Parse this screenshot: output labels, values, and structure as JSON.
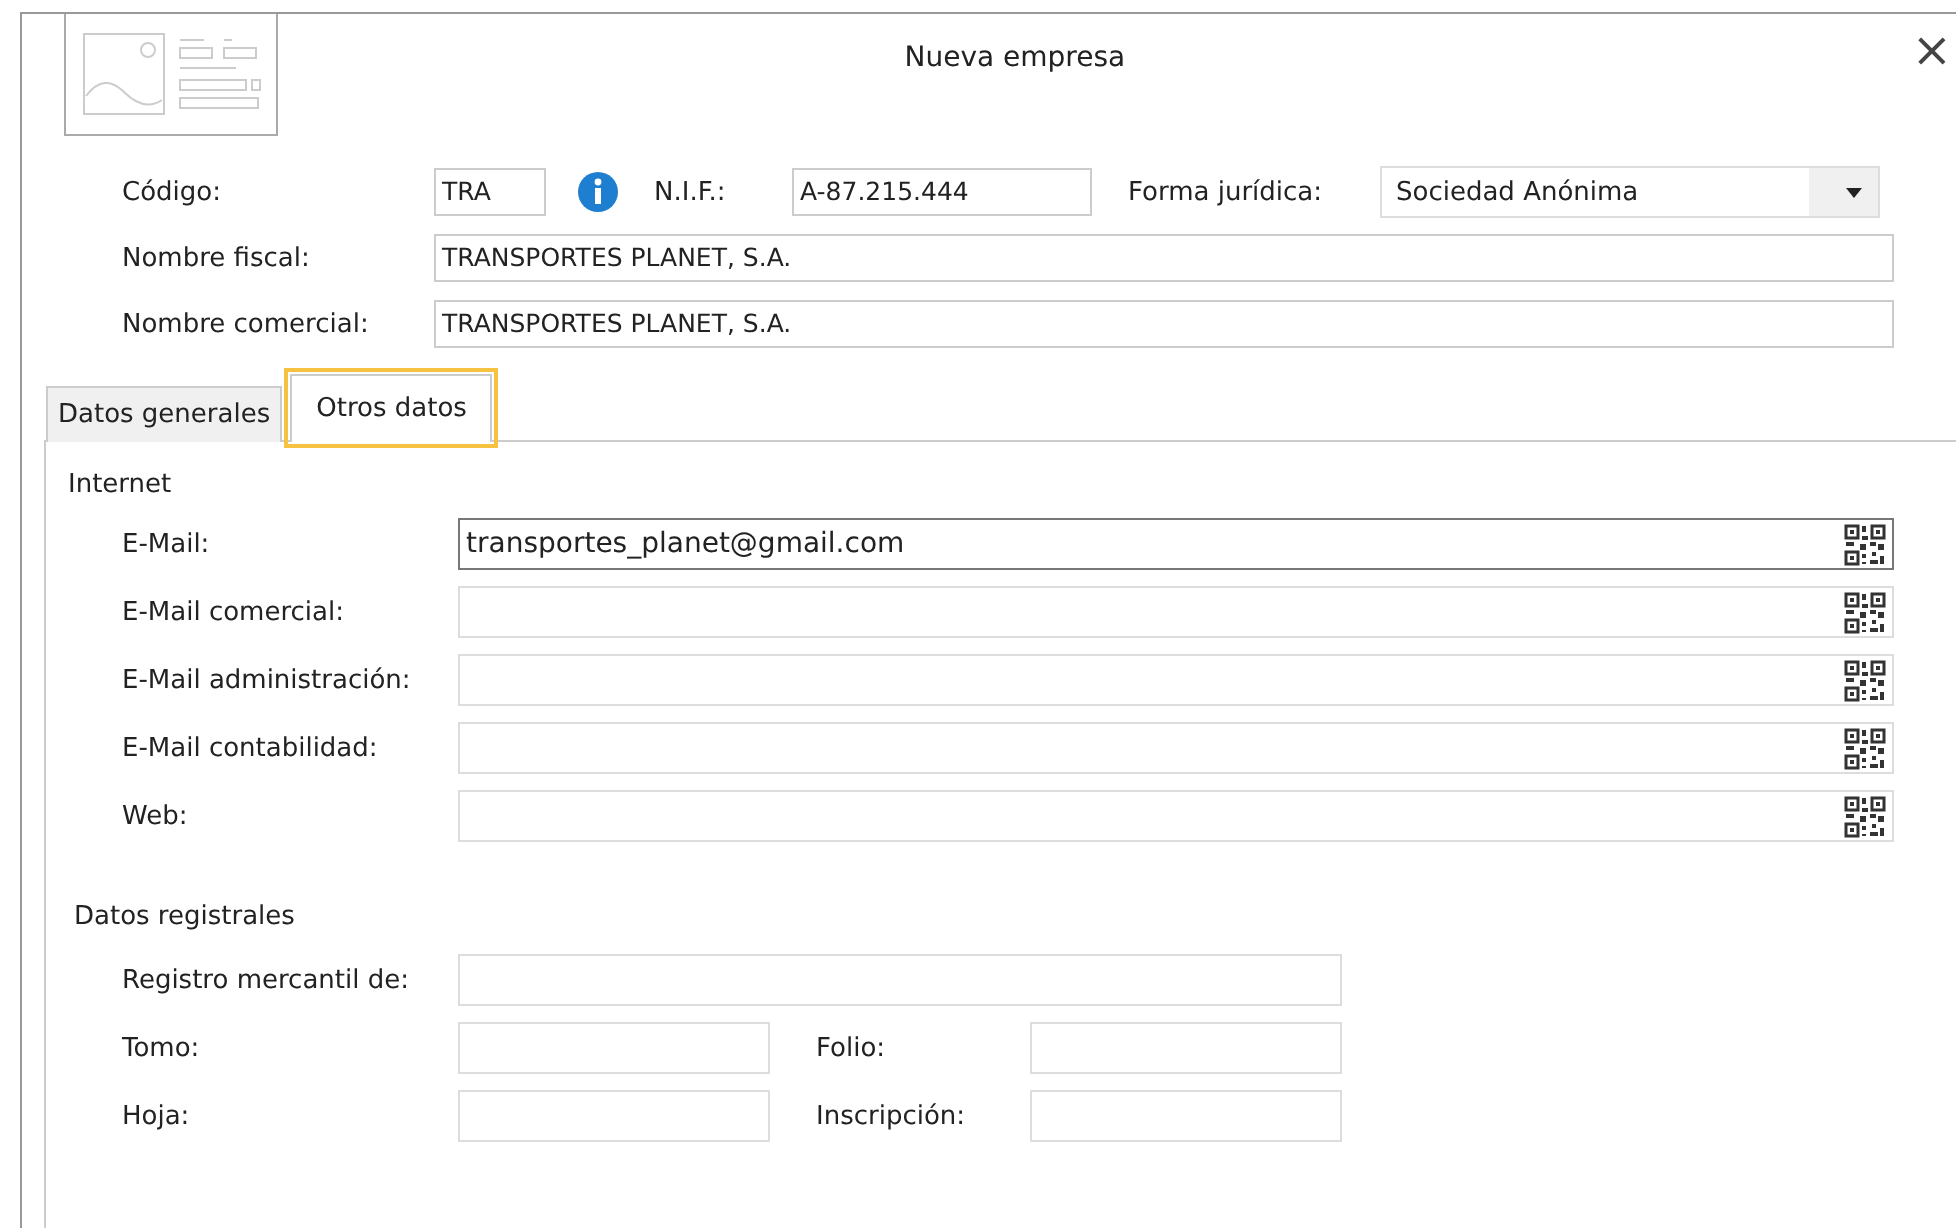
{
  "window": {
    "title": "Nueva empresa",
    "close": "×"
  },
  "header": {
    "codigo": {
      "label": "Código:",
      "value": "TRA"
    },
    "nif": {
      "label": "N.I.F.:",
      "value": "A-87.215.444"
    },
    "forma": {
      "label": "Forma jurídica:",
      "value": "Sociedad Anónima"
    },
    "nombre_fiscal": {
      "label": "Nombre fiscal:",
      "value": "TRANSPORTES PLANET, S.A."
    },
    "nombre_comercial": {
      "label": "Nombre comercial:",
      "value": "TRANSPORTES PLANET, S.A."
    }
  },
  "tabs": [
    {
      "label": "Datos generales",
      "selected": false
    },
    {
      "label": "Otros datos",
      "selected": true
    }
  ],
  "internet": {
    "title": "Internet",
    "fields": [
      {
        "label": "E-Mail:",
        "value": "transportes_planet@gmail.com",
        "focused": true
      },
      {
        "label": "E-Mail comercial:",
        "focused": false
      },
      {
        "label": "E-Mail administración:",
        "focused": false
      },
      {
        "label": "E-Mail contabilidad:",
        "focused": false
      },
      {
        "label": "Web:",
        "focused": false
      }
    ]
  },
  "registro": {
    "title": "Datos registrales",
    "mercantil": {
      "label": "Registro mercantil de:"
    },
    "tomo": {
      "label": "Tomo:"
    },
    "folio": {
      "label": "Folio:"
    },
    "hoja": {
      "label": "Hoja:"
    },
    "inscripcion": {
      "label": "Inscripción:"
    }
  }
}
